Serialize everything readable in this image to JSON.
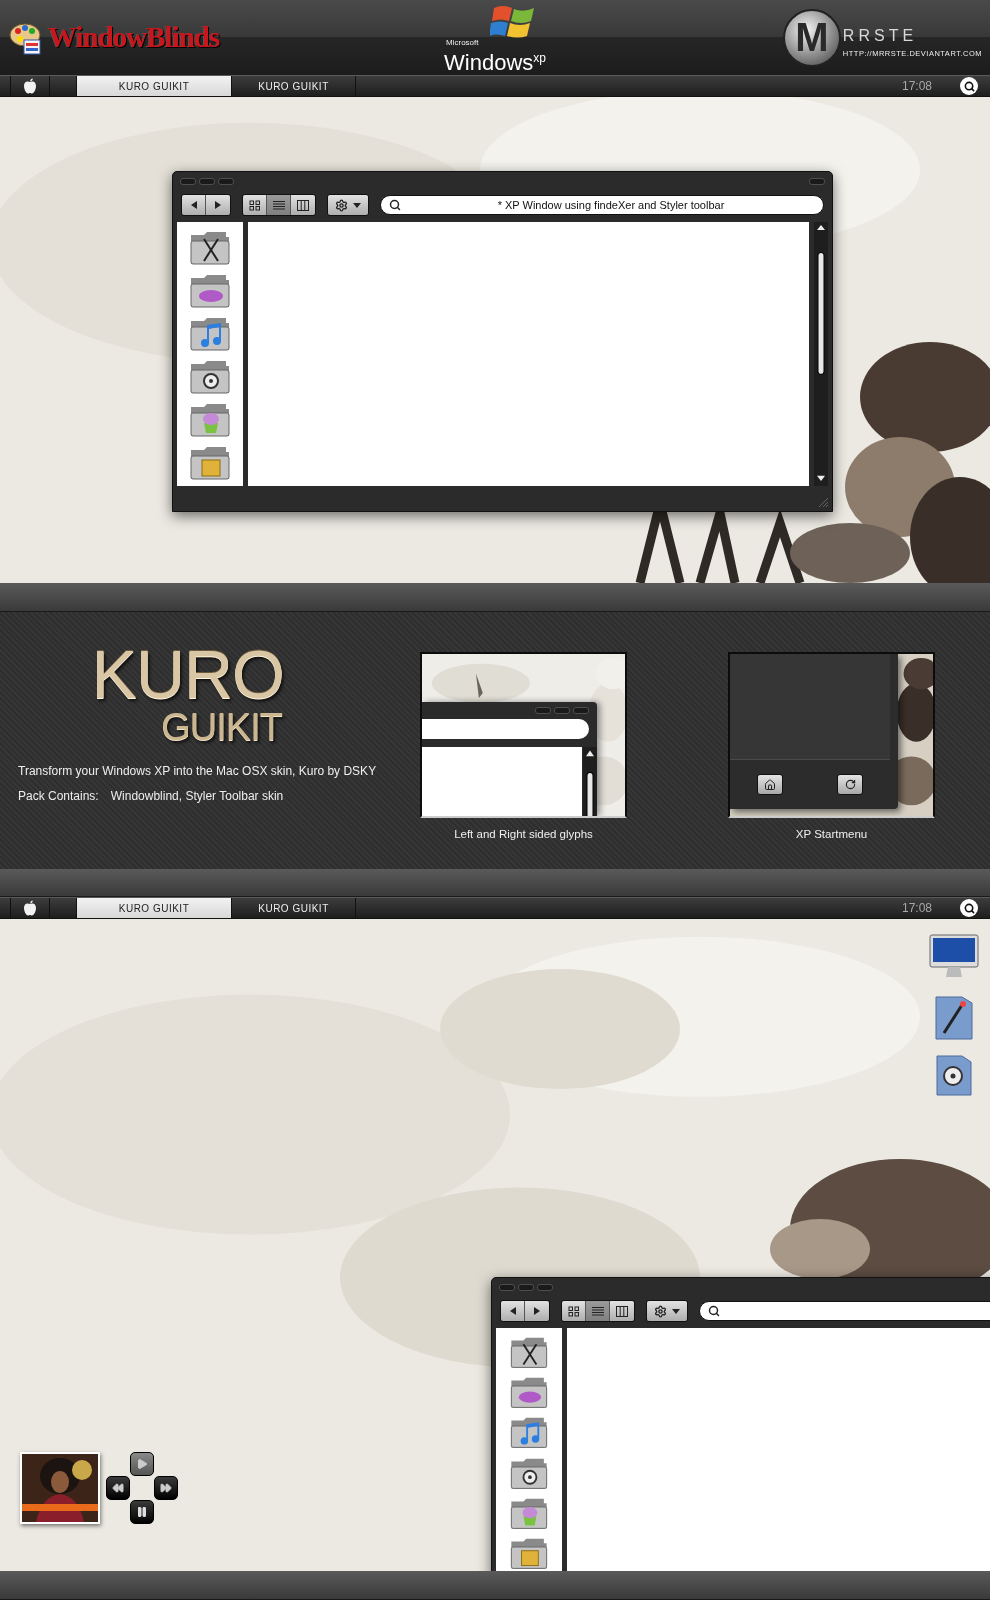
{
  "header": {
    "left_logo": "WindowBlinds",
    "center_logo_small": "Microsoft",
    "center_logo": "Windows$^{xp}$",
    "right_logo_mark": "M",
    "right_logo": "RRSTE",
    "right_logo_url": "HTTP://MRRSTE.DEVIANTART.COM"
  },
  "menubars": [
    {
      "tabs": [
        {
          "label": "KURO GUIKIT",
          "selected": true
        },
        {
          "label": "KURO GUIKIT",
          "selected": false
        }
      ],
      "clock": "17:08"
    },
    {
      "tabs": [
        {
          "label": "KURO GUIKIT",
          "selected": true
        },
        {
          "label": "KURO GUIKIT",
          "selected": false
        }
      ],
      "clock": "17:08"
    }
  ],
  "top_window": {
    "view_buttons": [
      {
        "kind": "icons",
        "selected": false
      },
      {
        "kind": "list",
        "selected": true
      },
      {
        "kind": "columns",
        "selected": false
      }
    ],
    "search": {
      "value": "* XP Window using findeXer and Styler toolbar"
    }
  },
  "promo": {
    "title": "KURO",
    "subtitle": "GUIKIT",
    "description": "Transform your Windows XP into the Mac OSX skin, Kuro by DSKY",
    "contents_label": "Pack Contains:",
    "contents": "Windowblind, Styler Toolbar skin",
    "previews": [
      {
        "kind": "glyphs",
        "caption": "Left and Right sided glyphs"
      },
      {
        "kind": "startmenu",
        "caption": "XP Startmenu"
      }
    ]
  },
  "bottom_window": {
    "view_buttons": [
      {
        "kind": "icons",
        "selected": false
      },
      {
        "kind": "list",
        "selected": true
      },
      {
        "kind": "columns",
        "selected": false
      }
    ]
  }
}
